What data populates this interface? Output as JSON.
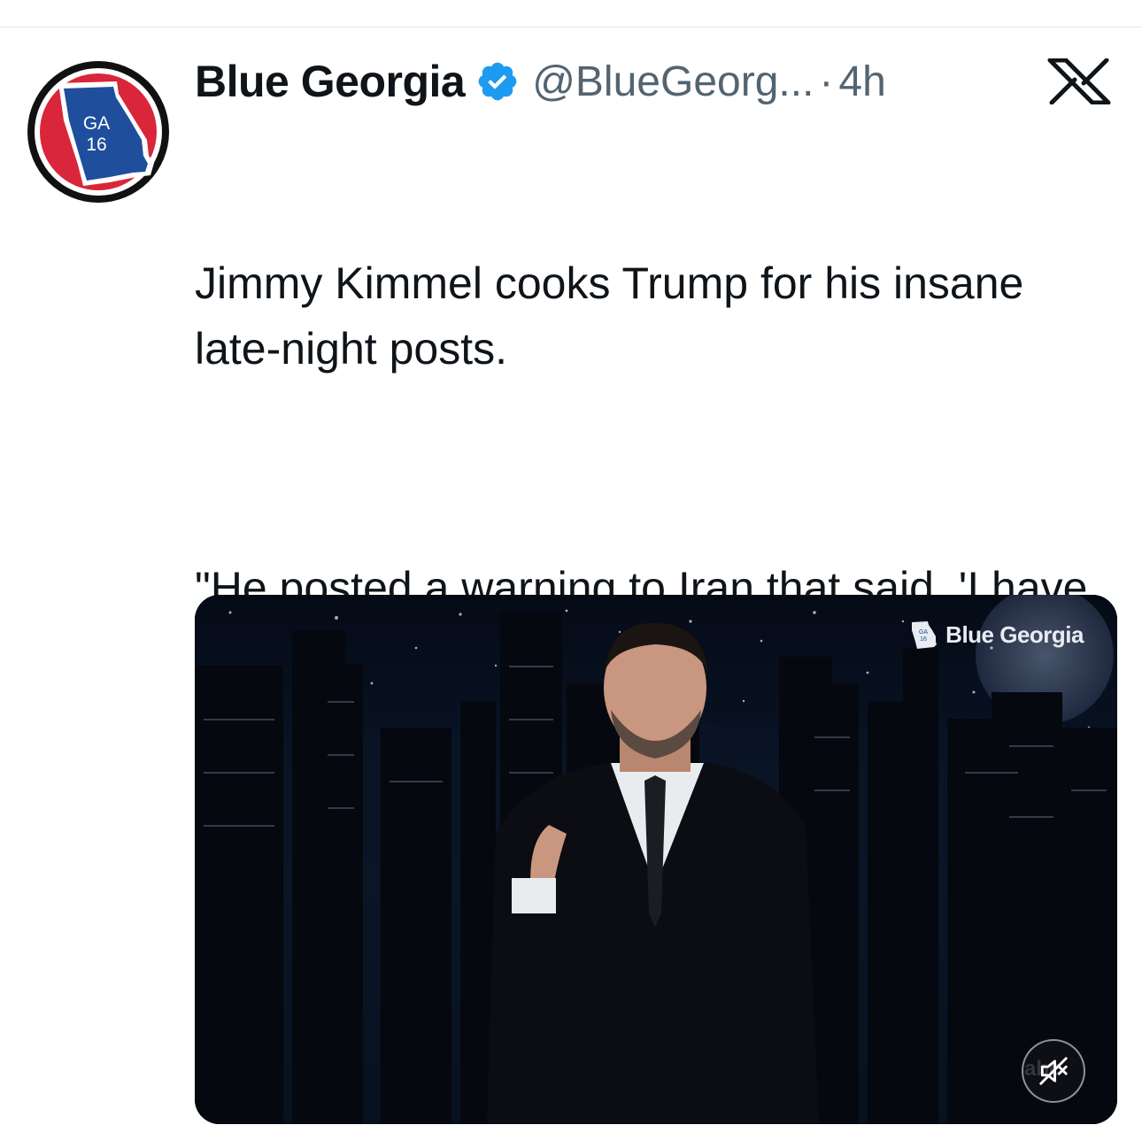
{
  "post": {
    "author": {
      "display_name": "Blue Georgia",
      "handle": "@BlueGeorg...",
      "separator": "·",
      "time": "4h",
      "avatar_text_line1": "GA",
      "avatar_text_line2": "16",
      "verified": true
    },
    "text_paragraphs": [
      "Jimmy Kimmel cooks Trump for his insane late-night posts.",
      "\"He posted a warning to Iran that said, 'I have all the cards,' and holding a bunch of UNO cards, which is a game you win by having no cards.\""
    ],
    "media": {
      "type": "video",
      "watermark_label": "Blue Georgia",
      "watermark_badge_line1": "GA",
      "watermark_badge_line2": "16",
      "network_bug": "abc",
      "mute_icon": "speaker-muted-icon"
    }
  },
  "icons": {
    "platform_logo": "x-logo-icon",
    "verified_badge": "verified-badge-icon"
  },
  "colors": {
    "verified_blue": "#1d9bf0",
    "text_primary": "#0f1419",
    "text_secondary": "#536471",
    "avatar_red": "#d9263a",
    "avatar_blue": "#1f4e9c"
  }
}
